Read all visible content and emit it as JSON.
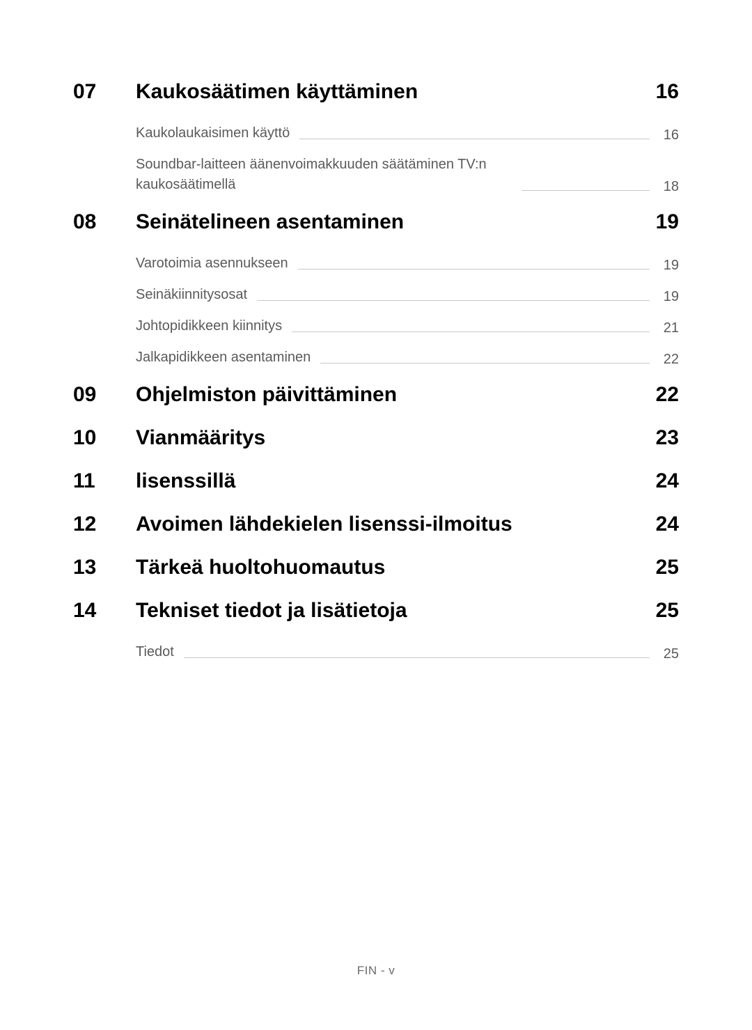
{
  "toc": [
    {
      "number": "07",
      "title": "Kaukosäätimen käyttäminen",
      "page": "16",
      "subs": [
        {
          "title": "Kaukolaukaisimen käyttö",
          "page": "16"
        },
        {
          "title": "Soundbar-laitteen äänenvoimakkuuden säätäminen TV:n kaukosäätimellä",
          "page": "18"
        }
      ]
    },
    {
      "number": "08",
      "title": "Seinätelineen asentaminen",
      "page": "19",
      "subs": [
        {
          "title": "Varotoimia asennukseen",
          "page": "19"
        },
        {
          "title": "Seinäkiinnitysosat",
          "page": "19"
        },
        {
          "title": "Johtopidikkeen kiinnitys",
          "page": "21"
        },
        {
          "title": "Jalkapidikkeen asentaminen",
          "page": "22"
        }
      ]
    },
    {
      "number": "09",
      "title": "Ohjelmiston päivittäminen",
      "page": "22",
      "subs": []
    },
    {
      "number": "10",
      "title": "Vianmääritys",
      "page": "23",
      "subs": []
    },
    {
      "number": "11",
      "title": "lisenssillä",
      "page": "24",
      "subs": []
    },
    {
      "number": "12",
      "title": "Avoimen lähdekielen lisenssi-ilmoitus",
      "page": "24",
      "subs": []
    },
    {
      "number": "13",
      "title": "Tärkeä huoltohuomautus",
      "page": "25",
      "subs": []
    },
    {
      "number": "14",
      "title": "Tekniset tiedot ja lisätietoja",
      "page": "25",
      "subs": [
        {
          "title": "Tiedot",
          "page": "25"
        }
      ]
    }
  ],
  "footer": "FIN - v"
}
